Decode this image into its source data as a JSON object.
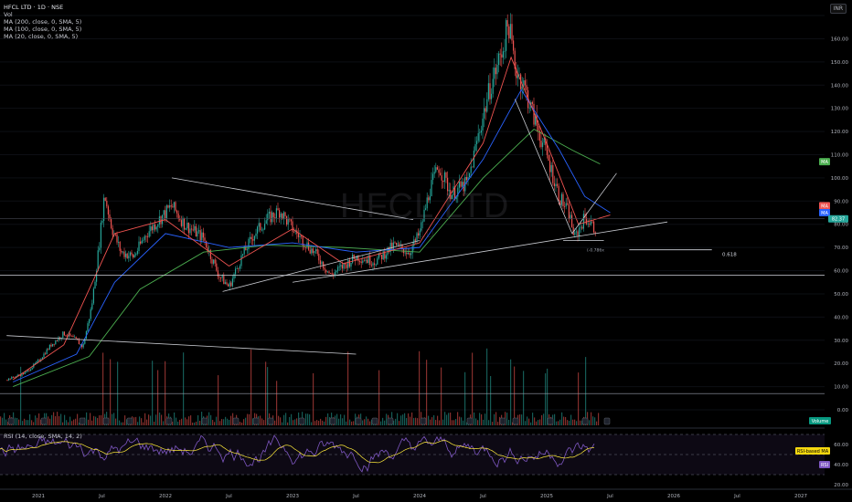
{
  "symbol_line": "HFCL LTD · 1D · NSE",
  "indicators": [
    "Vol",
    "MA (200, close, 0, SMA, 5)",
    "MA (100, close, 0, SMA, 5)",
    "MA (20, close, 0, SMA, 5)"
  ],
  "rsi_label": "RSI (14, close, SMA, 14, 2)",
  "currency": "INR",
  "watermark": "HFCL LTD",
  "watermark_sub": "1D",
  "fib_label": "0.618",
  "fib_small_label": "(-0.786x",
  "badges": {
    "ma_green": "MA",
    "ma_red": "MA",
    "ma_blue": "MA",
    "price": "82.37",
    "volume": "Volume",
    "rsi_ma": "RSI-based MA",
    "rsi": "RSI"
  },
  "colors": {
    "up": "#26a69a",
    "down": "#ef5350",
    "ma20": "#ef5350",
    "ma100": "#2962ff",
    "ma200": "#4caf50",
    "rsi": "#7e57c2",
    "rsi_ma": "#ffeb3b"
  },
  "chart_data": {
    "type": "candlestick",
    "y_axis_ticks": [
      170,
      160,
      150,
      140,
      130,
      120,
      110,
      100,
      90,
      80,
      70,
      60,
      50,
      40,
      30,
      20,
      10,
      0
    ],
    "y_axis_tick_labels": [
      "170.00",
      "160.00",
      "150.00",
      "140.00",
      "130.00",
      "120.00",
      "110.00",
      "100.00",
      "90.00",
      "80.00",
      "70.00",
      "60.00",
      "50.00",
      "40.00",
      "30.00",
      "20.00",
      "10.00",
      "0.00"
    ],
    "rsi_ticks": [
      60,
      40,
      20
    ],
    "rsi_tick_labels": [
      "60.00",
      "40.00",
      "20.00"
    ],
    "x_axis_labels": [
      "2021",
      "Jul",
      "2022",
      "Jul",
      "2023",
      "Jul",
      "2024",
      "Jul",
      "2025",
      "Jul",
      "2026",
      "Jul",
      "2027"
    ],
    "last_price": 82.37,
    "price_path": [
      [
        2020.75,
        13
      ],
      [
        2020.9,
        16
      ],
      [
        2021.0,
        21
      ],
      [
        2021.1,
        28
      ],
      [
        2021.2,
        33
      ],
      [
        2021.3,
        30
      ],
      [
        2021.35,
        27
      ],
      [
        2021.42,
        45
      ],
      [
        2021.48,
        72
      ],
      [
        2021.52,
        93
      ],
      [
        2021.58,
        78
      ],
      [
        2021.65,
        68
      ],
      [
        2021.75,
        66
      ],
      [
        2021.85,
        76
      ],
      [
        2021.95,
        82
      ],
      [
        2022.05,
        88
      ],
      [
        2022.15,
        80
      ],
      [
        2022.3,
        74
      ],
      [
        2022.42,
        58
      ],
      [
        2022.5,
        53
      ],
      [
        2022.6,
        66
      ],
      [
        2022.7,
        76
      ],
      [
        2022.8,
        82
      ],
      [
        2022.9,
        86
      ],
      [
        2023.0,
        78
      ],
      [
        2023.1,
        72
      ],
      [
        2023.2,
        66
      ],
      [
        2023.3,
        58
      ],
      [
        2023.4,
        62
      ],
      [
        2023.5,
        66
      ],
      [
        2023.65,
        64
      ],
      [
        2023.8,
        71
      ],
      [
        2023.92,
        68
      ],
      [
        2024.0,
        76
      ],
      [
        2024.08,
        95
      ],
      [
        2024.15,
        105
      ],
      [
        2024.25,
        93
      ],
      [
        2024.38,
        98
      ],
      [
        2024.46,
        118
      ],
      [
        2024.55,
        138
      ],
      [
        2024.65,
        155
      ],
      [
        2024.7,
        167
      ],
      [
        2024.75,
        148
      ],
      [
        2024.82,
        140
      ],
      [
        2024.9,
        126
      ],
      [
        2025.0,
        110
      ],
      [
        2025.1,
        92
      ],
      [
        2025.18,
        84
      ],
      [
        2025.22,
        74
      ],
      [
        2025.3,
        83
      ],
      [
        2025.38,
        78
      ],
      [
        2025.46,
        92
      ],
      [
        2025.52,
        82
      ]
    ],
    "ma20": [
      [
        2020.8,
        13
      ],
      [
        2021.2,
        28
      ],
      [
        2021.6,
        76
      ],
      [
        2022.0,
        82
      ],
      [
        2022.5,
        62
      ],
      [
        2023.0,
        78
      ],
      [
        2023.4,
        63
      ],
      [
        2024.0,
        72
      ],
      [
        2024.5,
        115
      ],
      [
        2024.72,
        152
      ],
      [
        2025.0,
        115
      ],
      [
        2025.25,
        80
      ],
      [
        2025.5,
        84
      ]
    ],
    "ma100": [
      [
        2020.8,
        12
      ],
      [
        2021.3,
        24
      ],
      [
        2021.6,
        55
      ],
      [
        2022.0,
        76
      ],
      [
        2022.5,
        70
      ],
      [
        2023.0,
        72
      ],
      [
        2023.5,
        68
      ],
      [
        2024.0,
        70
      ],
      [
        2024.5,
        108
      ],
      [
        2024.8,
        138
      ],
      [
        2025.1,
        112
      ],
      [
        2025.3,
        92
      ],
      [
        2025.5,
        85
      ]
    ],
    "ma200": [
      [
        2020.8,
        10
      ],
      [
        2021.4,
        23
      ],
      [
        2021.8,
        52
      ],
      [
        2022.3,
        68
      ],
      [
        2022.8,
        71
      ],
      [
        2023.4,
        70
      ],
      [
        2024.0,
        68
      ],
      [
        2024.5,
        100
      ],
      [
        2024.9,
        121
      ],
      [
        2025.2,
        112
      ],
      [
        2025.42,
        106
      ]
    ],
    "trendlines": [
      {
        "from": [
          2022.05,
          100
        ],
        "to": [
          2023.95,
          82
        ]
      },
      {
        "from": [
          2022.45,
          51
        ],
        "to": [
          2024.0,
          73
        ]
      },
      {
        "from": [
          2023.0,
          55
        ],
        "to": [
          2025.95,
          81
        ]
      },
      {
        "from": [
          2020.75,
          32
        ],
        "to": [
          2023.5,
          24
        ]
      },
      {
        "from": [
          2024.75,
          134
        ],
        "to": [
          2025.2,
          76
        ]
      },
      {
        "from": [
          2025.2,
          76
        ],
        "to": [
          2025.55,
          102
        ]
      }
    ],
    "horizontal_levels": [
      58,
      82.37,
      7
    ],
    "fib_level": {
      "value": 69,
      "label": "0.618"
    },
    "rsi_range": [
      20,
      75
    ]
  }
}
